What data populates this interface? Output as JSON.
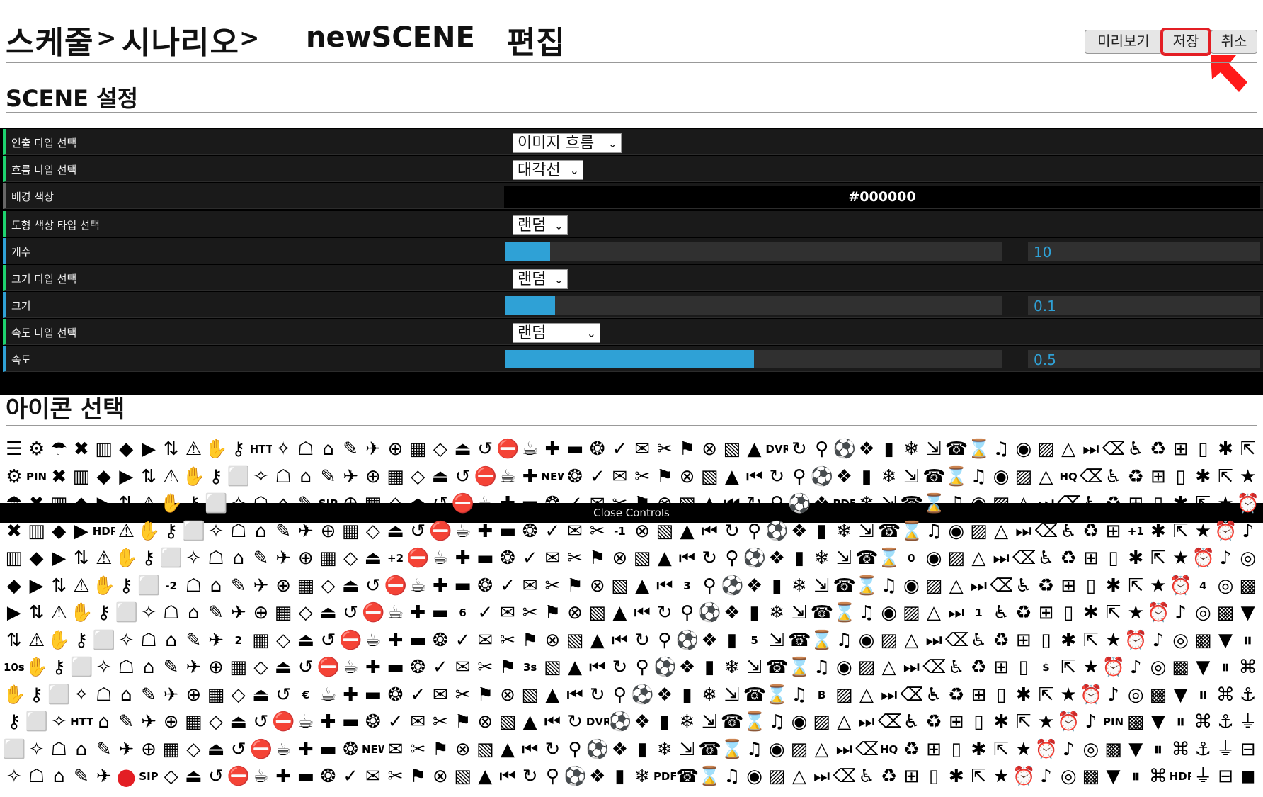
{
  "header": {
    "crumbs": [
      "스케줄",
      "시나리오"
    ],
    "separator": ">",
    "scene_name": "newSCENE",
    "edit_label": "편집",
    "buttons": {
      "preview": "미리보기",
      "save": "저장",
      "cancel": "취소"
    }
  },
  "scene_settings": {
    "title": "SCENE 설정",
    "rows": [
      {
        "label": "연출 타입 선택",
        "value": "이미지 흐름"
      },
      {
        "label": "흐름 타입 선택",
        "value": "대각선"
      },
      {
        "label": "배경 색상",
        "value": "#000000"
      },
      {
        "label": "도형 색상 타입 선택",
        "value": "랜덤"
      },
      {
        "label": "개수",
        "value": "10",
        "fraction": 0.09
      },
      {
        "label": "크기 타입 선택",
        "value": "랜덤"
      },
      {
        "label": "크기",
        "value": "0.1",
        "fraction": 0.1
      },
      {
        "label": "속도 타입 선택",
        "value": "랜덤"
      },
      {
        "label": "속도",
        "value": "0.5",
        "fraction": 0.5
      }
    ],
    "close_label": "Close Controls"
  },
  "icon_section": {
    "title": "아이콘 선택",
    "texts": [
      "HTTP",
      "DVR",
      "PIN",
      "NEW",
      "HQ",
      "SIP",
      "PDF",
      "HDR",
      "-1",
      "+1",
      "+2",
      "0",
      "-2",
      "3",
      "4",
      "6",
      "1",
      "2",
      "5",
      "10s",
      "3s",
      "$",
      "€",
      "B"
    ]
  },
  "colors": {
    "accent": "#2fa1d6",
    "panel_bg": "#1a1a1a",
    "highlight": "#e31e24",
    "status_dot": "#e31e24"
  }
}
